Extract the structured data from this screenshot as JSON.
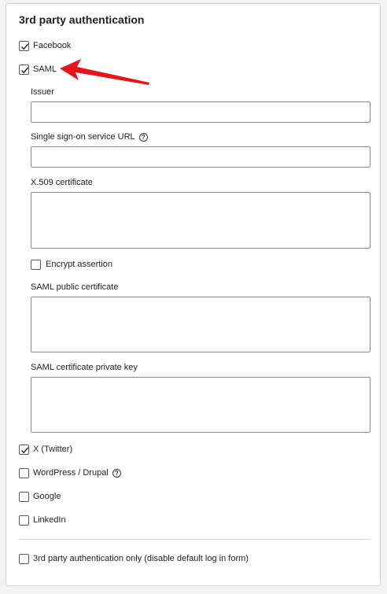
{
  "section_title": "3rd party authentication",
  "providers": {
    "facebook": {
      "label": "Facebook",
      "checked": true
    },
    "saml": {
      "label": "SAML",
      "checked": true
    },
    "twitter": {
      "label": "X (Twitter)",
      "checked": true
    },
    "wordpress": {
      "label": "WordPress / Drupal",
      "checked": false
    },
    "google": {
      "label": "Google",
      "checked": false
    },
    "linkedin": {
      "label": "LinkedIn",
      "checked": false
    }
  },
  "saml_settings": {
    "issuer_label": "Issuer",
    "issuer_value": "",
    "sso_url_label": "Single sign-on service URL",
    "sso_url_value": "",
    "x509_label": "X.509 certificate",
    "x509_value": "",
    "encrypt_label": "Encrypt assertion",
    "encrypt_checked": false,
    "public_cert_label": "SAML public certificate",
    "public_cert_value": "",
    "private_key_label": "SAML certificate private key",
    "private_key_value": ""
  },
  "only_third_party": {
    "label": "3rd party authentication only (disable default log in form)",
    "checked": false
  },
  "help_icon_symbol": "?",
  "annotation_arrow_color": "#e8141b"
}
